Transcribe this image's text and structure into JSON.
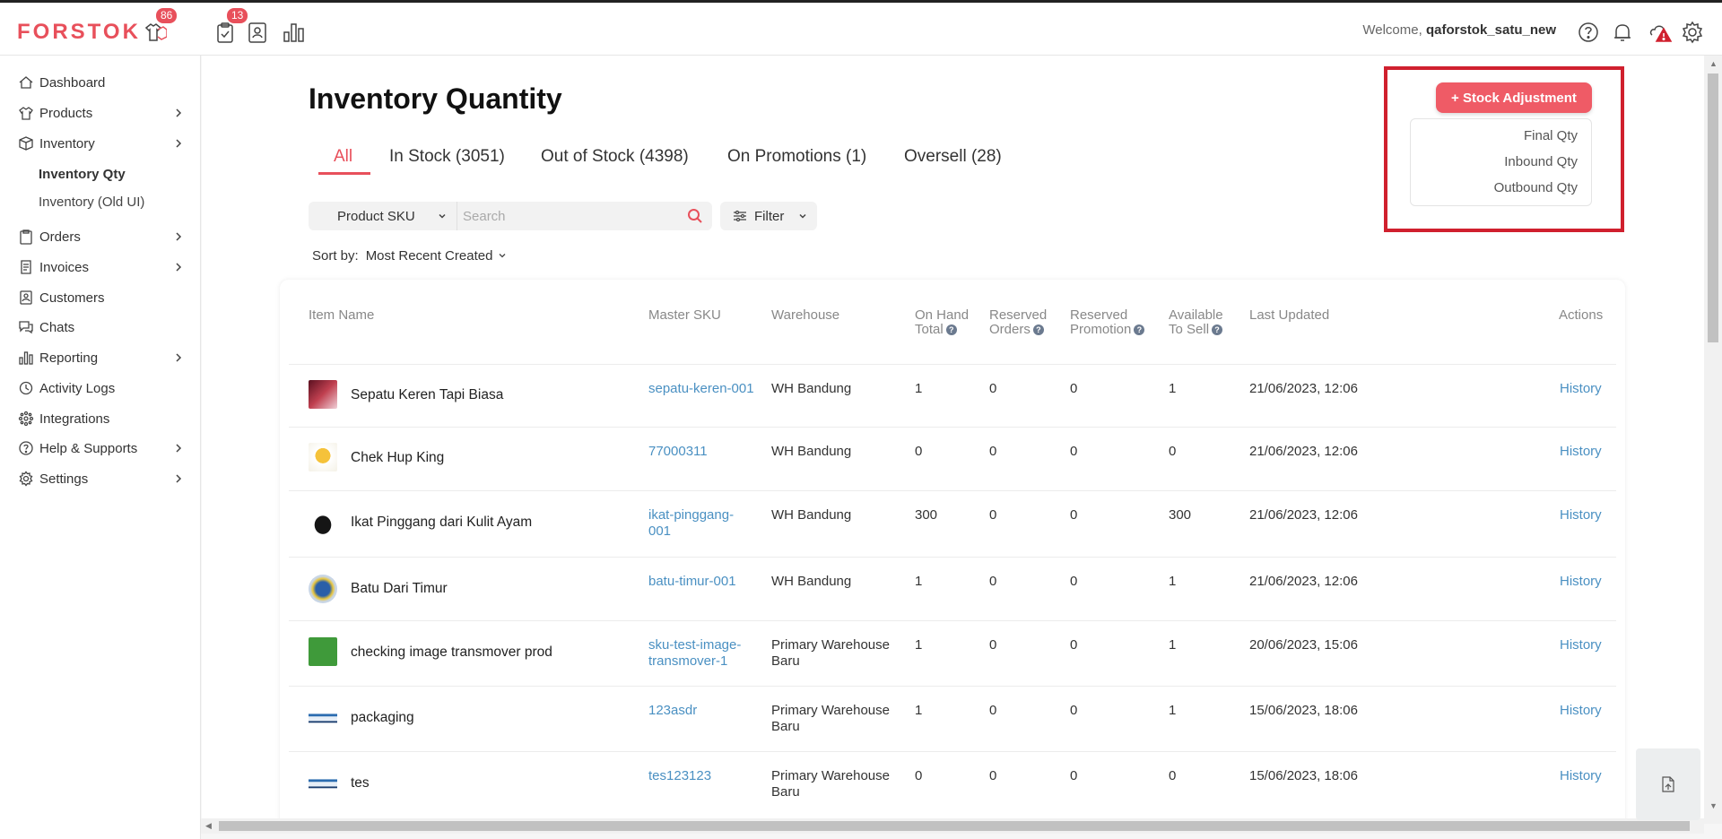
{
  "app": {
    "logo_text": "FORSTOK",
    "brand_color": "#e8505b"
  },
  "topbar": {
    "badges": {
      "shirt": "86",
      "task": "13"
    },
    "welcome_prefix": "Welcome, ",
    "username": "qaforstok_satu_new",
    "icons": [
      "shirt-box-icon",
      "clipboard-check-icon",
      "contact-card-icon",
      "bar-chart-icon",
      "help-icon",
      "bell-icon",
      "alert-cloud-icon",
      "gear-icon"
    ]
  },
  "sidebar": {
    "items": [
      {
        "label": "Dashboard",
        "icon": "home-icon",
        "expandable": false
      },
      {
        "label": "Products",
        "icon": "shirt-icon",
        "expandable": true
      },
      {
        "label": "Inventory",
        "icon": "box-icon",
        "expandable": true
      },
      {
        "label": "Orders",
        "icon": "clipboard-icon",
        "expandable": true
      },
      {
        "label": "Invoices",
        "icon": "invoice-icon",
        "expandable": true
      },
      {
        "label": "Customers",
        "icon": "contact-icon",
        "expandable": false
      },
      {
        "label": "Chats",
        "icon": "chat-icon",
        "expandable": false
      },
      {
        "label": "Reporting",
        "icon": "bar-chart-icon",
        "expandable": true
      },
      {
        "label": "Activity Logs",
        "icon": "history-icon",
        "expandable": false
      },
      {
        "label": "Integrations",
        "icon": "integrations-icon",
        "expandable": false
      },
      {
        "label": "Help & Supports",
        "icon": "help-icon",
        "expandable": true
      },
      {
        "label": "Settings",
        "icon": "gear-icon",
        "expandable": true
      }
    ],
    "subitems": [
      {
        "label": "Inventory Qty",
        "active": true
      },
      {
        "label": "Inventory (Old UI)",
        "active": false
      }
    ]
  },
  "main": {
    "title": "Inventory Quantity",
    "tabs": [
      {
        "label": "All",
        "active": true
      },
      {
        "label": "In Stock (3051)",
        "active": false
      },
      {
        "label": "Out of Stock (4398)",
        "active": false
      },
      {
        "label": "On Promotions (1)",
        "active": false
      },
      {
        "label": "Oversell (28)",
        "active": false
      }
    ],
    "search": {
      "field_label": "Product SKU",
      "placeholder": "Search"
    },
    "filter_label": "Filter",
    "sort": {
      "label": "Sort by:",
      "value": "Most Recent Created"
    },
    "actions": {
      "stock_adjustment_label": "+ Stock Adjustment",
      "dropdown": [
        "Final Qty",
        "Inbound Qty",
        "Outbound Qty"
      ]
    }
  },
  "table": {
    "columns": {
      "item_name": "Item Name",
      "master_sku": "Master SKU",
      "warehouse": "Warehouse",
      "on_hand_1": "On Hand",
      "on_hand_2": "Total",
      "reserved_orders_1": "Reserved",
      "reserved_orders_2": "Orders",
      "reserved_promo_1": "Reserved",
      "reserved_promo_2": "Promotion",
      "available_1": "Available",
      "available_2": "To Sell",
      "last_updated": "Last Updated",
      "actions": "Actions"
    },
    "rows": [
      {
        "name": "Sepatu Keren Tapi Biasa",
        "sku": [
          "sepatu-keren-001"
        ],
        "warehouse": [
          "WH Bandung"
        ],
        "on_hand": "1",
        "reserved_orders": "0",
        "reserved_promo": "0",
        "available": "1",
        "updated": "21/06/2023, 12:06",
        "action": "History"
      },
      {
        "name": "Chek Hup King",
        "sku": [
          "77000311"
        ],
        "warehouse": [
          "WH Bandung"
        ],
        "on_hand": "0",
        "reserved_orders": "0",
        "reserved_promo": "0",
        "available": "0",
        "updated": "21/06/2023, 12:06",
        "action": "History"
      },
      {
        "name": "Ikat Pinggang dari Kulit Ayam",
        "sku": [
          "ikat-pinggang-",
          "001"
        ],
        "warehouse": [
          "WH Bandung"
        ],
        "on_hand": "300",
        "reserved_orders": "0",
        "reserved_promo": "0",
        "available": "300",
        "updated": "21/06/2023, 12:06",
        "action": "History"
      },
      {
        "name": "Batu Dari Timur",
        "sku": [
          "batu-timur-001"
        ],
        "warehouse": [
          "WH Bandung"
        ],
        "on_hand": "1",
        "reserved_orders": "0",
        "reserved_promo": "0",
        "available": "1",
        "updated": "21/06/2023, 12:06",
        "action": "History"
      },
      {
        "name": "checking image transmover prod",
        "sku": [
          "sku-test-image-",
          "transmover-1"
        ],
        "warehouse": [
          "Primary Warehouse",
          "Baru"
        ],
        "on_hand": "1",
        "reserved_orders": "0",
        "reserved_promo": "0",
        "available": "1",
        "updated": "20/06/2023, 15:06",
        "action": "History"
      },
      {
        "name": "packaging",
        "sku": [
          "123asdr"
        ],
        "warehouse": [
          "Primary Warehouse",
          "Baru"
        ],
        "on_hand": "1",
        "reserved_orders": "0",
        "reserved_promo": "0",
        "available": "1",
        "updated": "15/06/2023, 18:06",
        "action": "History"
      },
      {
        "name": "tes",
        "sku": [
          "tes123123"
        ],
        "warehouse": [
          "Primary Warehouse",
          "Baru"
        ],
        "on_hand": "0",
        "reserved_orders": "0",
        "reserved_promo": "0",
        "available": "0",
        "updated": "15/06/2023, 18:06",
        "action": "History"
      }
    ],
    "thumbnails": [
      "shoe-thumbnail",
      "snack-thumbnail",
      "belt-figure-thumbnail",
      "globe-thumbnail",
      "bucket-thumbnail",
      "packaging-thumbnail",
      "packaging-thumbnail"
    ]
  }
}
